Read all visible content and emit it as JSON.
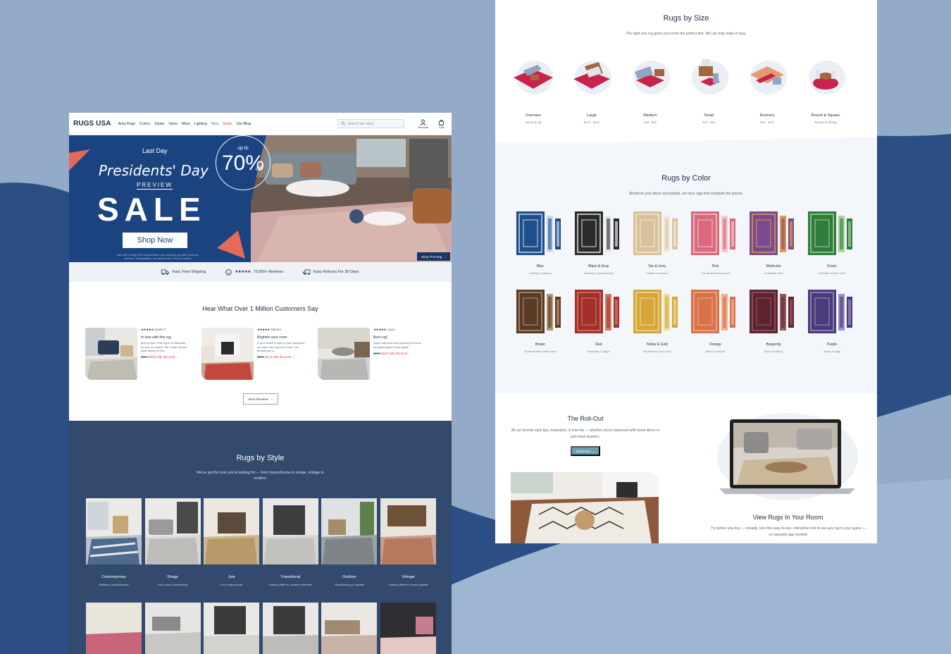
{
  "nav": {
    "logo": "RUGS USA",
    "items": [
      "Area Rugs",
      "Colors",
      "Styles",
      "Sizes",
      "More",
      "Lighting",
      "New",
      "Deals",
      "Our Blog"
    ],
    "search_placeholder": "Search our store",
    "account_label": "Account",
    "cart_label": "Cart"
  },
  "hero": {
    "last_day": "Last Day",
    "title": "Presidents' Day",
    "preview": "PREVIEW",
    "sale": "SALE",
    "upto": "up to",
    "percent": "70%",
    "off": "off",
    "cta": "Shop Now",
    "fine_print": "Sale valid on Rugs USA branded items only, excluding rug pads, closeouts, clearance, rechargeables, and sample sets. Prices as marked.",
    "shop_this_rug": "Shop This Rug"
  },
  "benefits": [
    {
      "icon": "truck-icon",
      "label": "Fast, Free Shipping"
    },
    {
      "icon": "smiley-icon",
      "label": "79,500+ Reviews",
      "stars": "★★★★★"
    },
    {
      "icon": "return-icon",
      "label": "Easy Returns For 30 Days"
    }
  ],
  "reviews": {
    "title": "Hear What Over 1 Million Customers Say",
    "items": [
      {
        "stars": "★★★★★",
        "name": "Sarah P.",
        "headline": "In love with this rug",
        "body": "Buy it now!!! This rug is so beautiful, so soft, so perfect. My 2 year old has been laying on this...",
        "old_price": "$584",
        "new_price": "$306 with discount →"
      },
      {
        "stars": "★★★★★",
        "name": "Marsha",
        "headline": "Brighten your room",
        "body": "If your house is dark or your furnitures are dark, this rug is the must. I've already got a...",
        "old_price": "$367",
        "new_price": "$173 with discount →"
      },
      {
        "stars": "★★★★★",
        "name": "Laura",
        "headline": "Best rug!",
        "body": "Super soft and looks amazing! Neutral and goes good in any space",
        "old_price": "$288",
        "new_price": "$147 with discount →"
      }
    ],
    "more": "More Reviews"
  },
  "styles": {
    "title": "Rugs by Style",
    "subtitle": "We've got the look you're looking for — from monochrome to ornate, vintage to modern.",
    "items": [
      {
        "name": "Contemporary",
        "desc": "Minimal & sophisticated"
      },
      {
        "name": "Shags",
        "desc": "Soft, cozy, & welcoming"
      },
      {
        "name": "Jute",
        "desc": "For a natural look"
      },
      {
        "name": "Transitional",
        "desc": "Classic patterns, modern materials"
      },
      {
        "name": "Outdoor",
        "desc": "Great-looking & durable"
      },
      {
        "name": "Vintage",
        "desc": "Classic patterns in every palette"
      }
    ]
  },
  "sizes": {
    "title": "Rugs by Size",
    "subtitle": "The right size rug gives your room the perfect feel. We can help make it easy.",
    "items": [
      {
        "name": "Oversize",
        "desc": "10x14 & Up"
      },
      {
        "name": "Large",
        "desc": "8x10 - 9x12"
      },
      {
        "name": "Medium",
        "desc": "5x8 - 6x9"
      },
      {
        "name": "Small",
        "desc": "2x3 - 4x6"
      },
      {
        "name": "Runners",
        "desc": "2x6 - 2x14"
      },
      {
        "name": "Round & Square",
        "desc": "Kitchen & dining"
      }
    ]
  },
  "colors": {
    "title": "Rugs by Color",
    "subtitle": "Whatever your décor and palette, we have rugs that complete the picture.",
    "items": [
      {
        "name": "Blue",
        "desc": "Inviting & calming",
        "c1": "#1f4f8a",
        "c2": "#c9d8ea"
      },
      {
        "name": "Black & Gray",
        "desc": "Neutral & eye-catching",
        "c1": "#2b2b2b",
        "c2": "#e6e6e6"
      },
      {
        "name": "Tan & Ivory",
        "desc": "Classic & serene",
        "c1": "#d9c29b",
        "c2": "#f4ead8"
      },
      {
        "name": "Pink",
        "desc": "The perfect boho touch",
        "c1": "#d96a7c",
        "c2": "#f2c9cf"
      },
      {
        "name": "Multicolor",
        "desc": "Celebrate color",
        "c1": "#7a4b8c",
        "c2": "#e09a4a"
      },
      {
        "name": "Green",
        "desc": "A breath of fresh color",
        "c1": "#2f7d3e",
        "c2": "#a9d19a"
      },
      {
        "name": "Brown",
        "desc": "Embraceable earth tones",
        "c1": "#5a3b28",
        "c2": "#b69470"
      },
      {
        "name": "Red",
        "desc": "Energetic & bright",
        "c1": "#a1302a",
        "c2": "#d67d6a"
      },
      {
        "name": "Yellow & Gold",
        "desc": "Sunshine for any room",
        "c1": "#d6a63a",
        "c2": "#f1dd9a"
      },
      {
        "name": "Orange",
        "desc": "Warm & mellow",
        "c1": "#d9724a",
        "c2": "#f0b08a"
      },
      {
        "name": "Burgundy",
        "desc": "Rich & inviting",
        "c1": "#5b2430",
        "c2": "#9b5a63"
      },
      {
        "name": "Purple",
        "desc": "Joyful & regal",
        "c1": "#4b3b7a",
        "c2": "#9f8fc4"
      }
    ]
  },
  "rollout": {
    "title": "The Roll-Out",
    "subtitle": "All our favorite style tips, inspiration, & how-tos — whether you're obsessed with home décor or just need answers.",
    "cta": "Read Now →"
  },
  "view_rugs": {
    "title": "View Rugs In Your Room",
    "subtitle": "Try before you buy — virtually. Use this easy-to-use, interactive tool to see any rug in your space — no separate app needed."
  },
  "colors_theme": {
    "navy": "#1a4380",
    "slate": "#324a6d",
    "accent_red": "#d9443b",
    "teal": "#6b9fad"
  }
}
